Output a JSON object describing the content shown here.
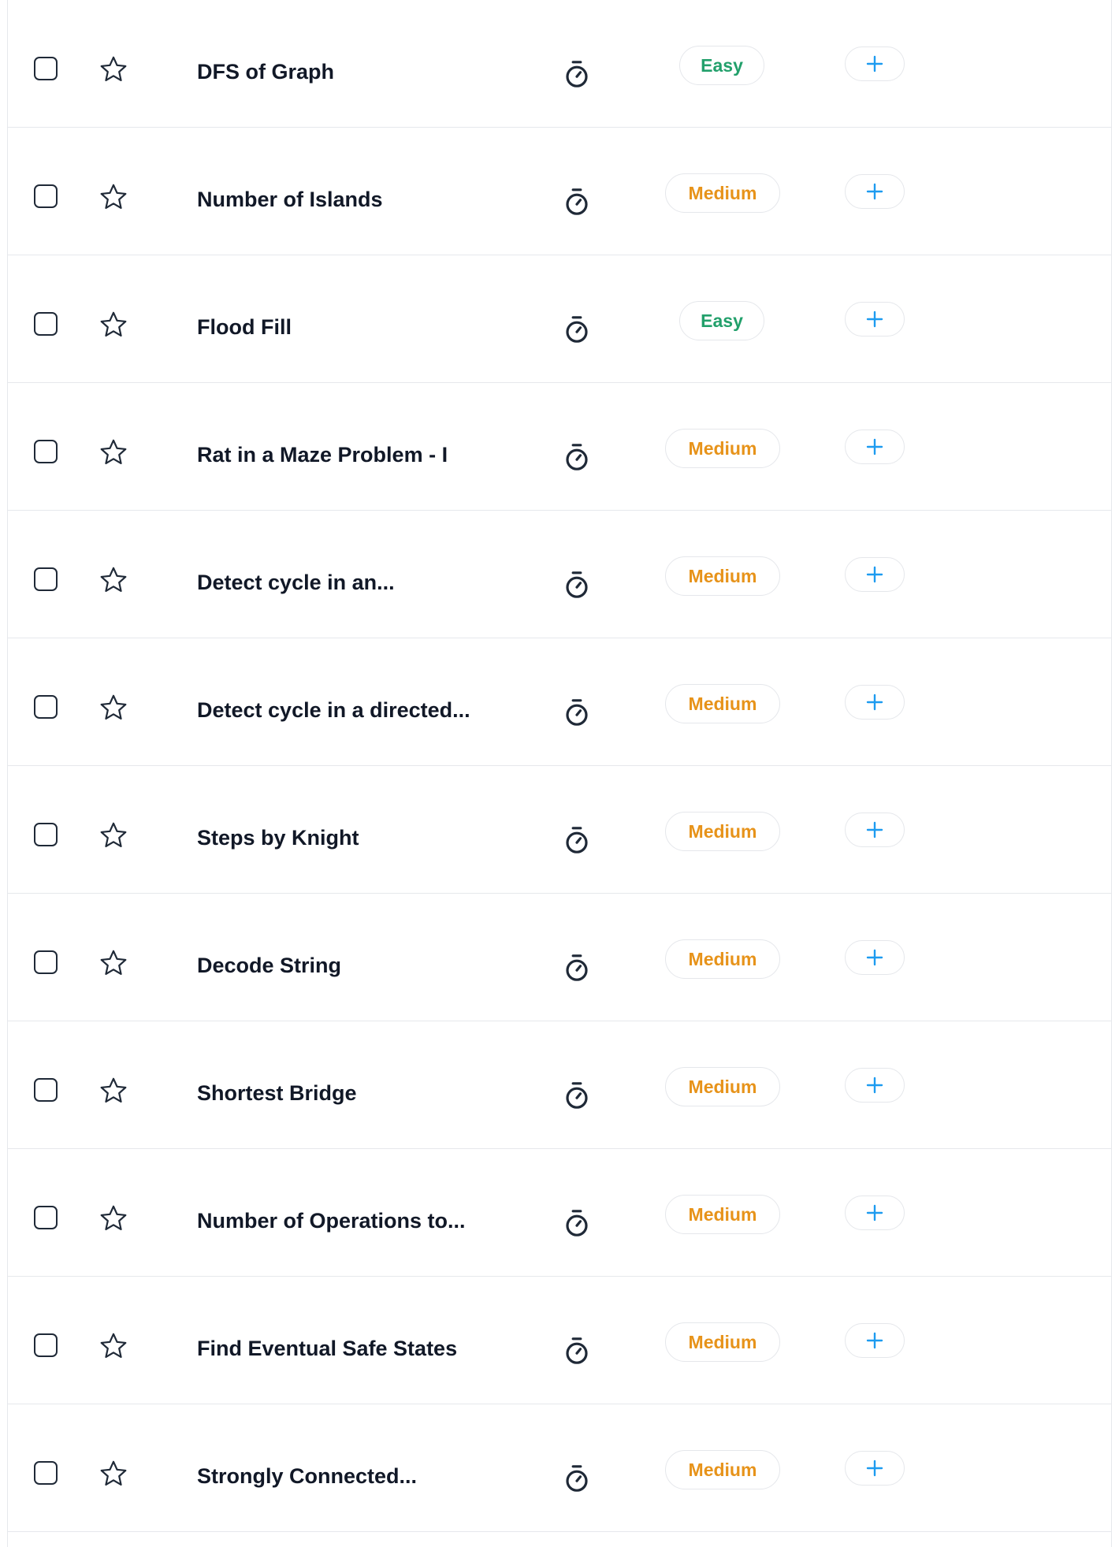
{
  "colors": {
    "easy": "#22a06b",
    "medium": "#e7931a",
    "accent": "#1d9bf0",
    "text": "#111827",
    "border": "#e6e8ec"
  },
  "icons": {
    "checkbox": "checkbox-icon",
    "star": "star-icon",
    "timer": "stopwatch-icon",
    "add": "plus-icon"
  },
  "problems": [
    {
      "title": "DFS of Graph",
      "difficulty": "Easy"
    },
    {
      "title": "Number of Islands",
      "difficulty": "Medium"
    },
    {
      "title": "Flood Fill",
      "difficulty": "Easy"
    },
    {
      "title": "Rat in a Maze Problem - I",
      "difficulty": "Medium"
    },
    {
      "title": "Detect cycle in an...",
      "difficulty": "Medium"
    },
    {
      "title": "Detect cycle in a directed...",
      "difficulty": "Medium"
    },
    {
      "title": "Steps by Knight",
      "difficulty": "Medium"
    },
    {
      "title": "Decode String",
      "difficulty": "Medium"
    },
    {
      "title": "Shortest Bridge",
      "difficulty": "Medium"
    },
    {
      "title": "Number of Operations to...",
      "difficulty": "Medium"
    },
    {
      "title": "Find Eventual Safe States",
      "difficulty": "Medium"
    },
    {
      "title": "Strongly Connected...",
      "difficulty": "Medium"
    }
  ]
}
